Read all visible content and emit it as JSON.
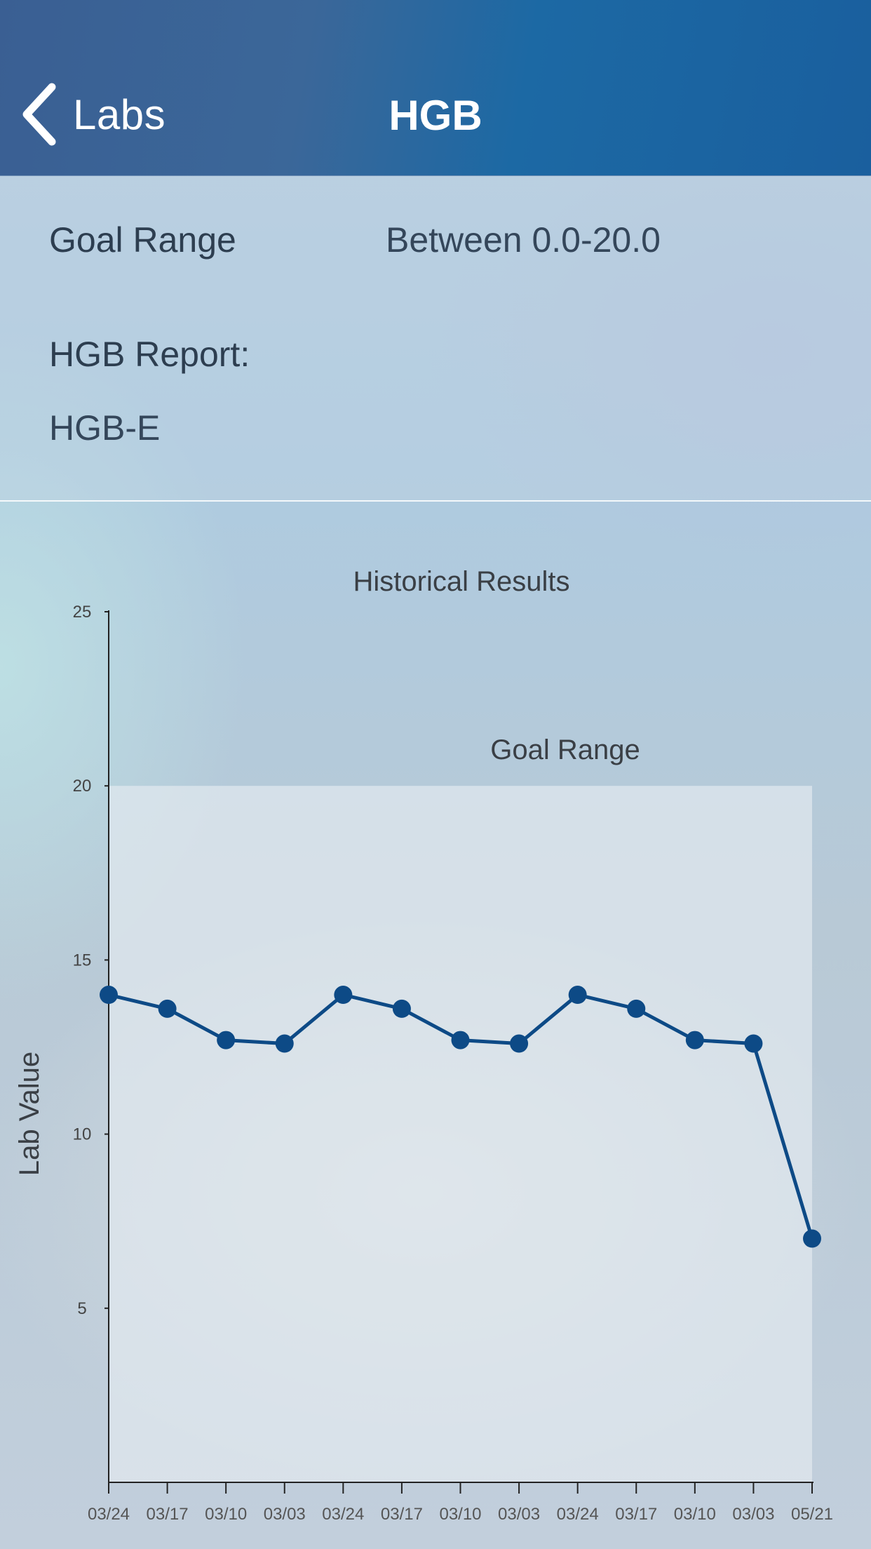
{
  "nav": {
    "back_label": "Labs",
    "title": "HGB"
  },
  "info": {
    "goal_range_label": "Goal Range",
    "goal_range_value": "Between 0.0-20.0",
    "report_label": "HGB Report:",
    "report_value": "HGB-E"
  },
  "colors": {
    "nav_bar": "#1c69a4",
    "series_line": "#0d4a86",
    "goal_band": "#e3eaf0"
  },
  "chart_data": {
    "type": "line",
    "title": "Historical Results",
    "xlabel": "",
    "ylabel": "Lab Value",
    "ylim": [
      0,
      25
    ],
    "yticks": [
      5,
      10,
      15,
      20,
      25
    ],
    "categories": [
      "03/24",
      "03/17",
      "03/10",
      "03/03",
      "03/24",
      "03/17",
      "03/10",
      "03/03",
      "03/24",
      "03/17",
      "03/10",
      "03/03",
      "05/21"
    ],
    "series": [
      {
        "values": [
          14.0,
          13.6,
          12.7,
          12.6,
          14.0,
          13.6,
          12.7,
          12.6,
          14.0,
          13.6,
          12.7,
          12.6,
          7.0
        ]
      }
    ],
    "goal_range": {
      "label": "Goal Range",
      "min": 0,
      "max": 20
    },
    "grid": false,
    "legend": "none"
  }
}
